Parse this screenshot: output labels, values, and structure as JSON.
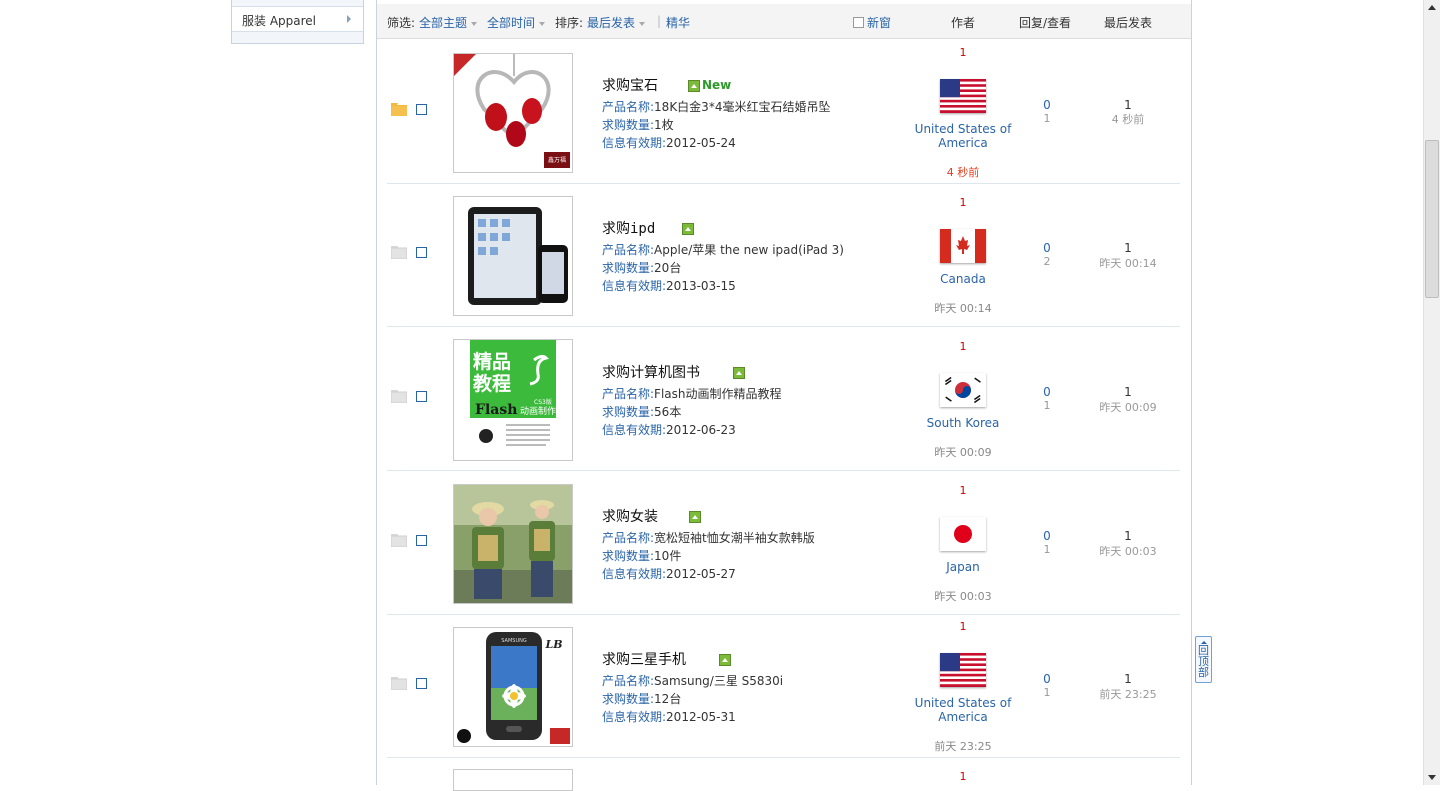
{
  "sidebar": {
    "item_label": "服装 Apparel"
  },
  "filterbar": {
    "filter_label": "筛选:",
    "all_topics": "全部主题",
    "all_time": "全部时间",
    "sort_label": "排序:",
    "sort_value": "最后发表",
    "separator": "|",
    "digest": "精华",
    "new_window": "新窗",
    "col_author": "作者",
    "col_replies": "回复/查看",
    "col_last": "最后发表"
  },
  "field_labels": {
    "product": "产品名称:",
    "quantity": "求购数量:",
    "valid": "信息有效期:"
  },
  "rows": [
    {
      "title": "求购宝石",
      "new_badge": "New",
      "product": "18K白金3*4毫米红宝石结婚吊坠",
      "quantity": "1枚",
      "valid": "2012-05-24",
      "count": "1",
      "country": "United States of America",
      "post_time": "4 秒前",
      "replies": "0",
      "views": "1",
      "last_count": "1",
      "last_time": "4 秒前",
      "folder": "new",
      "flag": "usa"
    },
    {
      "title": "求购ipd",
      "new_badge": "",
      "product": "Apple/苹果 the new ipad(iPad 3)",
      "quantity": "20台",
      "valid": "2013-03-15",
      "count": "1",
      "country": "Canada",
      "post_time": "昨天 00:14",
      "replies": "0",
      "views": "2",
      "last_count": "1",
      "last_time": "昨天 00:14",
      "folder": "normal",
      "flag": "canada"
    },
    {
      "title": "求购计算机图书",
      "new_badge": "",
      "product": "Flash动画制作精品教程",
      "quantity": "56本",
      "valid": "2012-06-23",
      "count": "1",
      "country": "South Korea",
      "post_time": "昨天 00:09",
      "replies": "0",
      "views": "1",
      "last_count": "1",
      "last_time": "昨天 00:09",
      "folder": "normal",
      "flag": "korea"
    },
    {
      "title": "求购女装",
      "new_badge": "",
      "product": "宽松短袖t恤女潮半袖女款韩版",
      "quantity": "10件",
      "valid": "2012-05-27",
      "count": "1",
      "country": "Japan",
      "post_time": "昨天 00:03",
      "replies": "0",
      "views": "1",
      "last_count": "1",
      "last_time": "昨天 00:03",
      "folder": "normal",
      "flag": "japan"
    },
    {
      "title": "求购三星手机",
      "new_badge": "",
      "product": "Samsung/三星 S5830i",
      "quantity": "12台",
      "valid": "2012-05-31",
      "count": "1",
      "country": "United States of America",
      "post_time": "前天 23:25",
      "replies": "0",
      "views": "1",
      "last_count": "1",
      "last_time": "前天 23:25",
      "folder": "normal",
      "flag": "usa"
    },
    {
      "title": "",
      "new_badge": "",
      "product": "",
      "quantity": "",
      "valid": "",
      "count": "1",
      "country": "",
      "post_time": "",
      "replies": "",
      "views": "",
      "last_count": "",
      "last_time": "",
      "folder": "normal",
      "flag": ""
    }
  ],
  "thumbs": {
    "row0_brand": "鑫万福",
    "row2_cover_line1": "精品",
    "row2_cover_line2": "教程",
    "row2_cover_line3": "Flash",
    "row2_cover_sub": "动画制作",
    "row2_cover_cs3": "CS3版",
    "row4_brand": "SAMSUNG",
    "row4_logo": "LB"
  },
  "backtop": {
    "c1": "回",
    "c2": "顶",
    "c3": "部"
  },
  "colors": {
    "link": "#2a64a8",
    "accent_red": "#c00000",
    "new_green": "#2e9a2e"
  }
}
